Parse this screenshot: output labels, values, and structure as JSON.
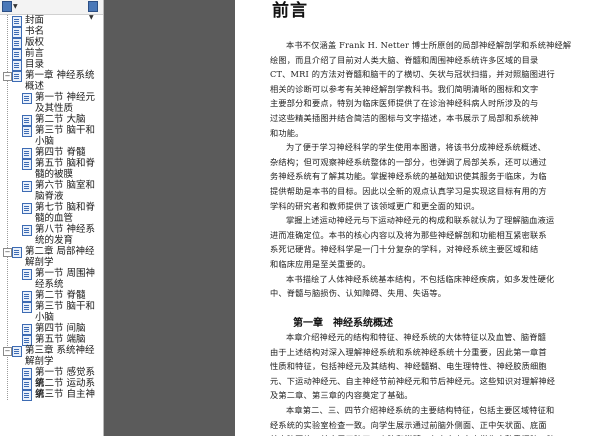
{
  "sidebar": {
    "toolbar": {
      "options_icon": "options-icon",
      "expand_icon": "bookmark-options-icon"
    },
    "items": [
      {
        "label": "封面",
        "level": 0
      },
      {
        "label": "书名",
        "level": 0
      },
      {
        "label": "版权",
        "level": 0
      },
      {
        "label": "前言",
        "level": 0
      },
      {
        "label": "目录",
        "level": 0
      },
      {
        "label": "第一章 神经系统概述",
        "level": 0,
        "toggle": "−"
      },
      {
        "label": "第一节 神经元及其性质",
        "level": 1
      },
      {
        "label": "第二节 大脑",
        "level": 1
      },
      {
        "label": "第三节 脑干和小脑",
        "level": 1
      },
      {
        "label": "第四节 脊髓",
        "level": 1
      },
      {
        "label": "第五节 脑和脊髓的被膜",
        "level": 1
      },
      {
        "label": "第六节 脑室和脑脊液",
        "level": 1
      },
      {
        "label": "第七节 脑和脊髓的血管",
        "level": 1
      },
      {
        "label": "第八节 神经系统的发育",
        "level": 1
      },
      {
        "label": "第二章 局部神经解剖学",
        "level": 0,
        "toggle": "−"
      },
      {
        "label": "第一节 周围神经系统",
        "level": 1
      },
      {
        "label": "第二节 脊髓",
        "level": 1
      },
      {
        "label": "第三节 脑干和小脑",
        "level": 1
      },
      {
        "label": "第四节 间脑",
        "level": 1
      },
      {
        "label": "第五节 端脑",
        "level": 1
      },
      {
        "label": "第三章 系统神经解剖学",
        "level": 0,
        "toggle": "−"
      },
      {
        "label": "第一节 感觉系统",
        "level": 1
      },
      {
        "label": "第二节 运动系统",
        "level": 1
      },
      {
        "label": "第三节 自主神",
        "level": 1
      }
    ]
  },
  "page": {
    "title": "前言",
    "lines": [
      "本书不仅涵盖 Frank H. Netter 博士所原创的局部神经解剖学和系统神经解",
      "绘图，而且介绍了目前对人类大脑、脊髓和周围神经系统许多区域的目录",
      "CT、MRI 的方法对脊髓和脑干的了横切、矢状与冠状扫描，并对照脑图进行",
      "相关的诊断可以参考有关神经解剖学教科书。我们简明清晰的图标和文字",
      "主要部分和要点，特别为临床医师提供了在诊治神经科病人时所涉及的与",
      "过这些精美插图并结合简洁的图标与文字描述，本书展示了局部和系统神",
      "和功能。",
      "为了便于学习神经科学的学生使用本图谱，将该书分成神经系统概述、",
      "杂结构；但可观察神经系统整体的一部分，也弹调了局部关系，还可以通过",
      "务神经系统有了解其功能。掌握神经系统的基础知识使其服务于临床，为临",
      "提供帮助是本书的目标。因此以全新的观点认真学习是实现这目标有用的方",
      "学科的研究者和教师提供了该领域更广和更全面的知识。",
      "掌握上述运动神经元与下运动神经元的构成和联系就认为了理解脑血液运",
      "进而准确定位。本书的核心内容以及将为那些神经解剖和功能相互紧密联系",
      "系死记硬背。神经科学是一门十分复杂的学科，对神经系统主要区域和结",
      "和临床应用是至关重要的。",
      "本书描绘了人体神经系统基本结构，不包括临床神经疾病，如多发性硬化",
      "中、脊髓与脑损伤、认知障碍、失用、失语等。"
    ],
    "section_heading": "第一章　神经系统概述",
    "section_lines": [
      "本章介绍神经元的结构和特征、神经系统的大体特征以及血管、脑脊髓",
      "由于上述结构对深入理解神经系统和系统神经系统十分重要，因此第一章首",
      "性质和特征，包括神经元及其结构、神经髓鞘、电生理特性、神经胶质细胞",
      "元、下运动神经元、自主神经节前神经元和节后神经元。这些知识对理解神经",
      "及第二章、第三章的内容奠定了基础。",
      "本章第二、三、四节介绍神经系统的主要结构特征，包括主要区域特征和",
      "经系统的实验室检查一致。向学生展示通过前脑外侧面、正中矢状面、底面",
      "幹大脑图片，并应用于脑干、小脑和脊髓。在本章内容中学生应熟悉间脑、脑"
    ]
  }
}
